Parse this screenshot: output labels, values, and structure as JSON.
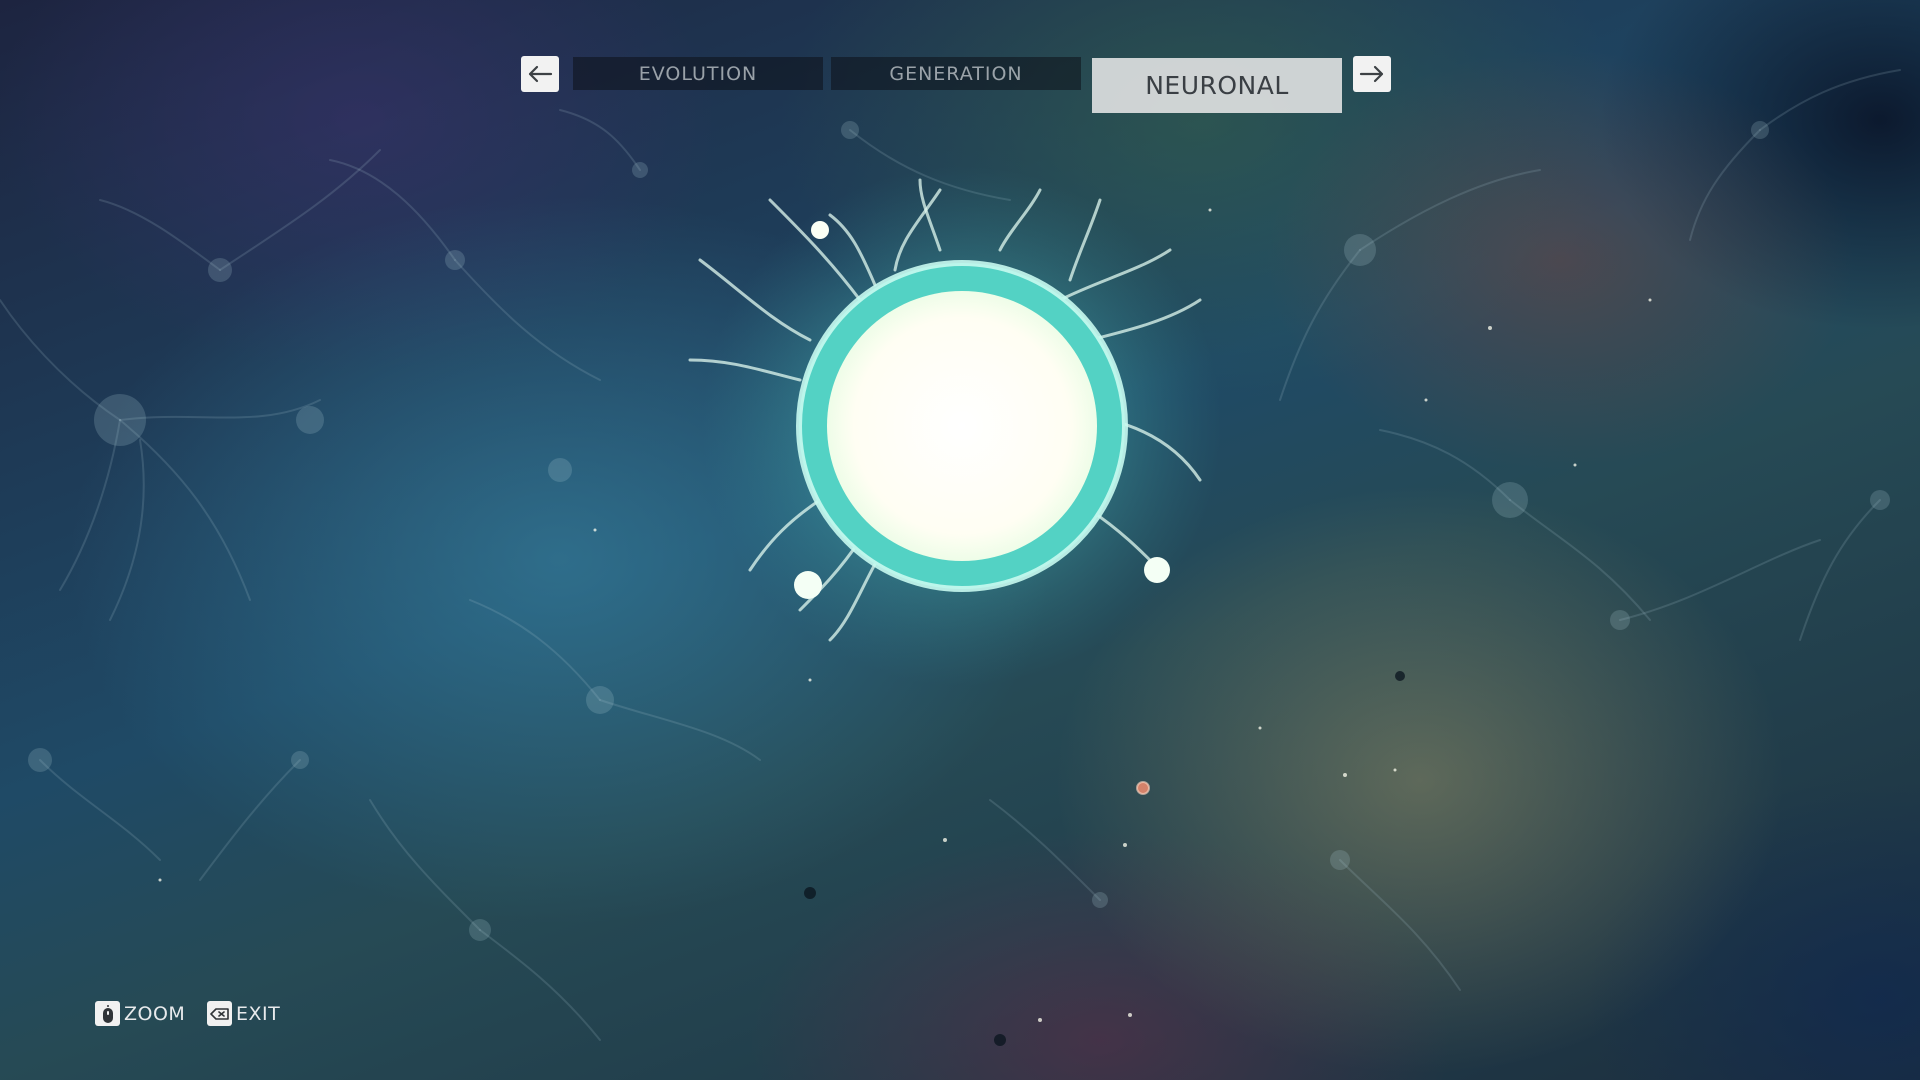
{
  "nav": {
    "prev_icon": "arrow-left-icon",
    "next_icon": "arrow-right-icon",
    "tabs": [
      {
        "label": "EVOLUTION",
        "active": false
      },
      {
        "label": "GENERATION",
        "active": false
      },
      {
        "label": "NEURONAL",
        "active": true
      }
    ]
  },
  "hints": [
    {
      "icon": "mouse-scroll-icon",
      "label": "ZOOM"
    },
    {
      "icon": "backspace-key-icon",
      "label": "EXIT"
    }
  ],
  "colors": {
    "orb_core": "#fffdf2",
    "orb_ring": "#5fe0cf",
    "tab_active_bg": "#dcdede",
    "tab_inactive_bg": "#0c1018"
  }
}
